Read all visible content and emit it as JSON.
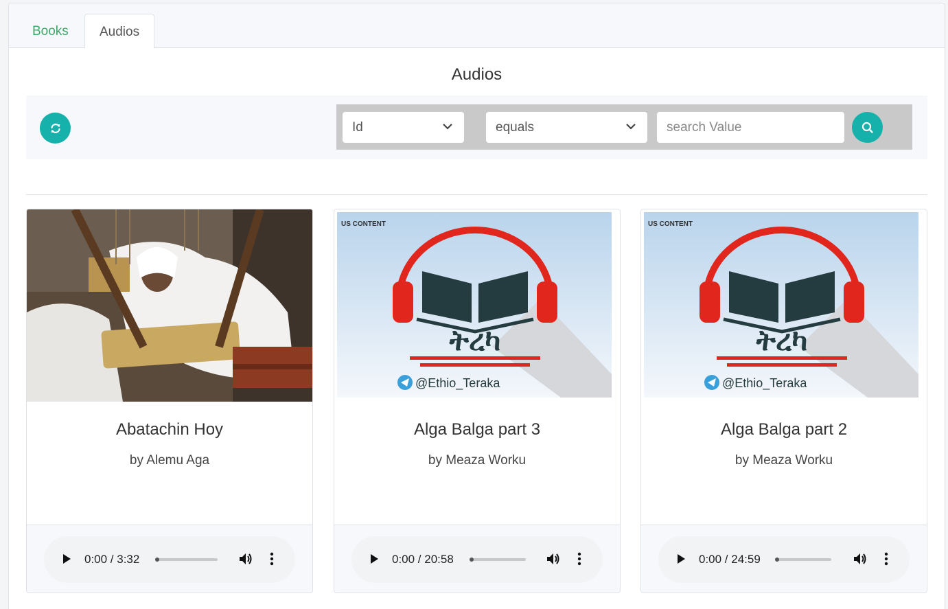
{
  "tabs": [
    {
      "label": "Books",
      "active": false
    },
    {
      "label": "Audios",
      "active": true
    }
  ],
  "page": {
    "title": "Audios"
  },
  "toolbar": {
    "refresh_icon": "refresh-icon",
    "field_select": {
      "value": "Id"
    },
    "operator_select": {
      "value": "equals"
    },
    "search": {
      "placeholder": "search Value",
      "value": ""
    },
    "search_icon": "search-icon",
    "accent_color": "#16b1aa"
  },
  "audios": [
    {
      "title": "Abatachin Hoy",
      "author": "by Alemu Aga",
      "player": {
        "time": "0:00 / 3:32",
        "progress": 0
      }
    },
    {
      "title": "Alga Balga part 3",
      "author": "by Meaza Worku",
      "cover_text": {
        "amharic": "ትረካ",
        "handle": "@Ethio_Teraka",
        "brand": "US CONTENT"
      },
      "player": {
        "time": "0:00 / 20:58",
        "progress": 0
      }
    },
    {
      "title": "Alga Balga part 2",
      "author": "by Meaza Worku",
      "cover_text": {
        "amharic": "ትረካ",
        "handle": "@Ethio_Teraka",
        "brand": "US CONTENT"
      },
      "player": {
        "time": "0:00 / 24:59",
        "progress": 0
      }
    }
  ]
}
